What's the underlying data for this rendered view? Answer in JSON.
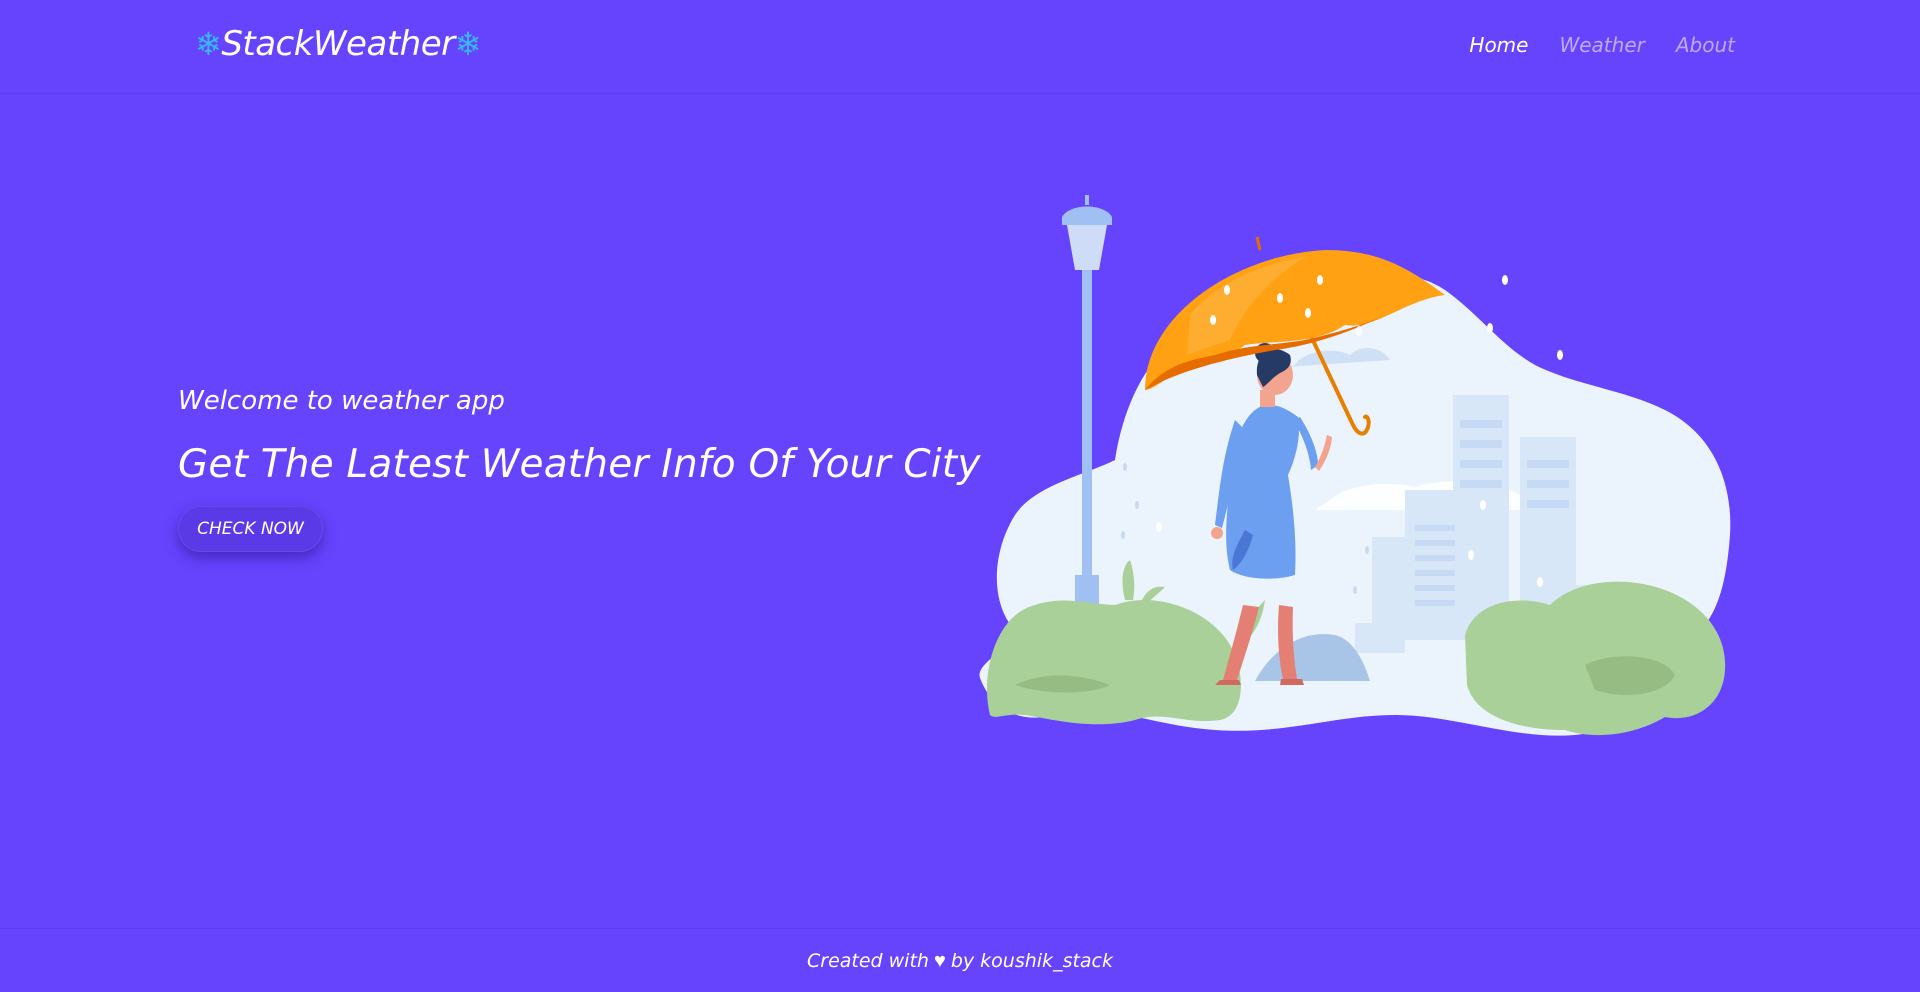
{
  "app": {
    "brand_prefix_icon": "snowflake-icon",
    "brand_name": "StackWeather",
    "brand_suffix_icon": "snowflake-icon",
    "brand_icon_color": "#35b9f2",
    "background_color": "#6644fe"
  },
  "nav": {
    "items": [
      {
        "label": "Home",
        "active": true
      },
      {
        "label": "Weather",
        "active": false
      },
      {
        "label": "About",
        "active": false
      }
    ]
  },
  "hero": {
    "welcome": "Welcome to weather app",
    "headline": "Get The Latest Weather Info Of Your City",
    "cta_label": "CHECK NOW",
    "illustration_icon": "woman-with-umbrella-in-rain-illustration"
  },
  "footer": {
    "prefix": "Created with",
    "heart_icon": "heart-icon",
    "suffix": "by koushik_stack"
  }
}
